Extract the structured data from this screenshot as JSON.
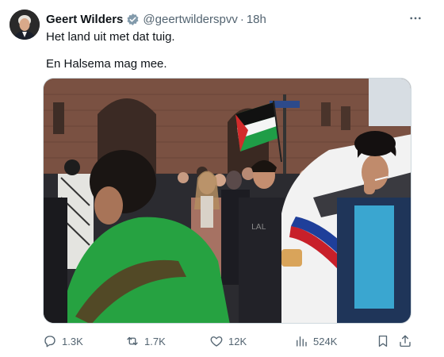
{
  "author": {
    "display_name": "Geert Wilders",
    "handle": "@geertwilderspvv",
    "separator": "·",
    "time": "18h",
    "verified_color": "#829aab"
  },
  "tweet": {
    "line1": "Het land uit met dat tuig.",
    "line2": "En Halsema mag mee."
  },
  "actions": {
    "reply_count": "1.3K",
    "repost_count": "1.7K",
    "like_count": "12K",
    "views_count": "524K"
  },
  "colors": {
    "text": "#0f1419",
    "secondary": "#536471",
    "border": "#cfd9de"
  },
  "icons": [
    "more-icon",
    "reply-icon",
    "repost-icon",
    "like-icon",
    "views-icon",
    "bookmark-icon",
    "share-icon",
    "verified-badge-icon"
  ]
}
